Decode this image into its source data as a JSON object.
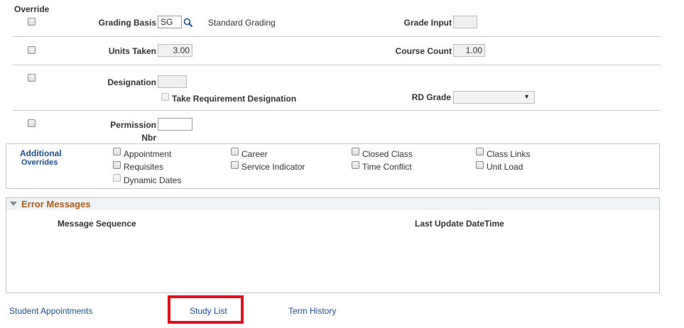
{
  "row1": {
    "override_label": "Override",
    "grading_basis_label": "Grading Basis",
    "grading_basis_value": "SG",
    "grading_basis_desc": "Standard Grading",
    "grade_input_label": "Grade Input",
    "grade_input_value": ""
  },
  "row2": {
    "units_taken_label": "Units Taken",
    "units_taken_value": "3.00",
    "course_count_label": "Course Count",
    "course_count_value": "1.00"
  },
  "row3": {
    "designation_label": "Designation",
    "designation_value": "",
    "take_req_label": "Take Requirement Designation",
    "rd_grade_label": "RD Grade",
    "rd_grade_value": ""
  },
  "row4": {
    "permission_label_line1": "Permission",
    "permission_label_line2": "Nbr",
    "permission_value": ""
  },
  "additional_overrides": {
    "title_line1": "Additional",
    "title_line2": "Overrides",
    "items": {
      "appointment": "Appointment",
      "career": "Career",
      "closed_class": "Closed Class",
      "class_links": "Class Links",
      "requisites": "Requisites",
      "service_indicator": "Service Indicator",
      "time_conflict": "Time Conflict",
      "unit_load": "Unit Load",
      "dynamic_dates": "Dynamic Dates"
    }
  },
  "error_messages": {
    "title": "Error Messages",
    "col_message_sequence": "Message Sequence",
    "col_last_update": "Last Update DateTime"
  },
  "footer_links": {
    "student_appointments": "Student Appointments",
    "study_list": "Study List",
    "term_history": "Term History"
  },
  "colors": {
    "link": "#1e4f8f",
    "error_header": "#b05a1a",
    "highlight_box": "#e3101a"
  }
}
